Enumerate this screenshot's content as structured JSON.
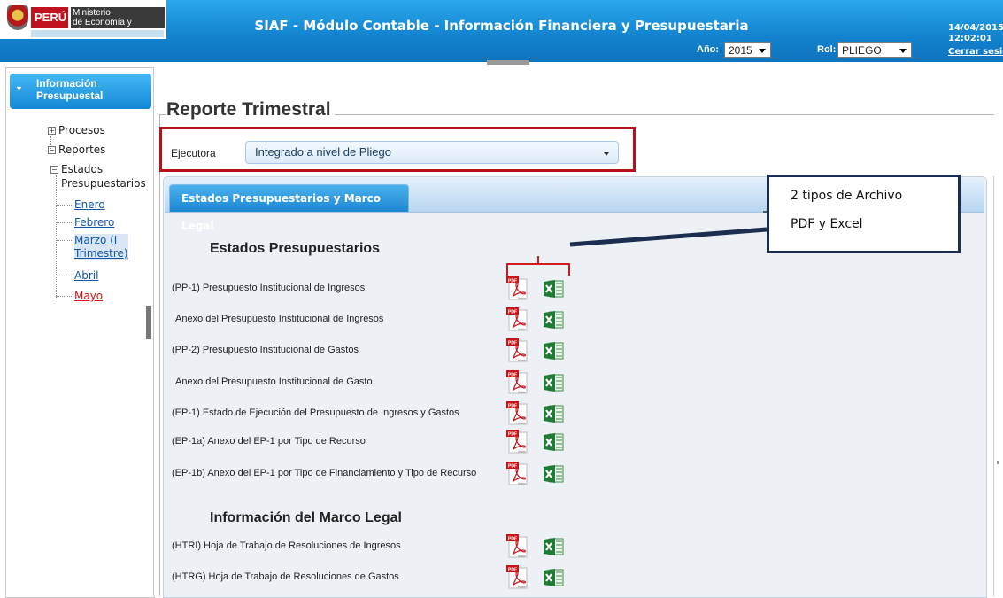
{
  "header": {
    "country": "PERÚ",
    "ministry_line1": "Ministerio",
    "ministry_line2": "de Economía y Finanzas",
    "title": "SIAF - Módulo Contable - Información Financiera y Presupuestaria",
    "year_label": "Año:",
    "year_value": "2015",
    "role_label": "Rol:",
    "role_value": "PLIEGO",
    "date": "14/04/2015",
    "time": "12:02:01",
    "logout": "Cerrar sesión",
    "colors": {
      "bar": "#1282cf",
      "peru_red": "#c1121f"
    }
  },
  "sidebar": {
    "header_line1": "Información",
    "header_line2": "Presupuestal",
    "procesos": "Procesos",
    "reportes": "Reportes",
    "estados_line1": "Estados",
    "estados_line2": "Presupuestarios",
    "months": [
      {
        "label": "Enero"
      },
      {
        "label": "Febrero"
      },
      {
        "label_line1": "Marzo (I",
        "label_line2": "Trimestre)"
      },
      {
        "label": "Abril"
      },
      {
        "label": "Mayo"
      }
    ]
  },
  "main": {
    "page_title": "Reporte Trimestral",
    "ejecutora_label": "Ejecutora",
    "ejecutora_value": "Integrado a nivel de Pliego",
    "tab_label": "Estados Presupuestarios y Marco Legal",
    "section1_title": "Estados Presupuestarios",
    "section1_rows": [
      {
        "label": "(PP-1) Presupuesto Institucional de Ingresos",
        "pdf": "pdf-icon",
        "excel": "excel-icon"
      },
      {
        "label": "Anexo del Presupuesto Institucional de Ingresos",
        "pdf": "pdf-icon",
        "excel": "excel-icon"
      },
      {
        "label": "(PP-2) Presupuesto Institucional de Gastos",
        "pdf": "pdf-icon",
        "excel": "excel-icon"
      },
      {
        "label": "Anexo del Presupuesto Institucional de Gasto",
        "pdf": "pdf-icon",
        "excel": "excel-icon"
      },
      {
        "label": "(EP-1) Estado de Ejecución del Presupuesto de Ingresos y Gastos",
        "pdf": "pdf-icon",
        "excel": "excel-icon"
      },
      {
        "label": "(EP-1a) Anexo del EP-1 por Tipo de Recurso",
        "pdf": "pdf-icon",
        "excel": "excel-icon"
      },
      {
        "label": "(EP-1b) Anexo del EP-1 por Tipo de Financiamiento y Tipo de Recurso",
        "pdf": "pdf-icon",
        "excel": "excel-icon"
      }
    ],
    "section2_title": "Información del Marco Legal",
    "section2_rows": [
      {
        "label": "(HTRI) Hoja de Trabajo de Resoluciones de Ingresos",
        "pdf": "pdf-icon",
        "excel": "excel-icon"
      },
      {
        "label": "(HTRG) Hoja de Trabajo de Resoluciones de Gastos",
        "pdf": "pdf-icon",
        "excel": "excel-icon"
      }
    ]
  },
  "callout": {
    "line1": "2 tipos de Archivo",
    "line2": "PDF y Excel",
    "highlight_color": "#b5121b",
    "box_color": "#1b2e52"
  }
}
